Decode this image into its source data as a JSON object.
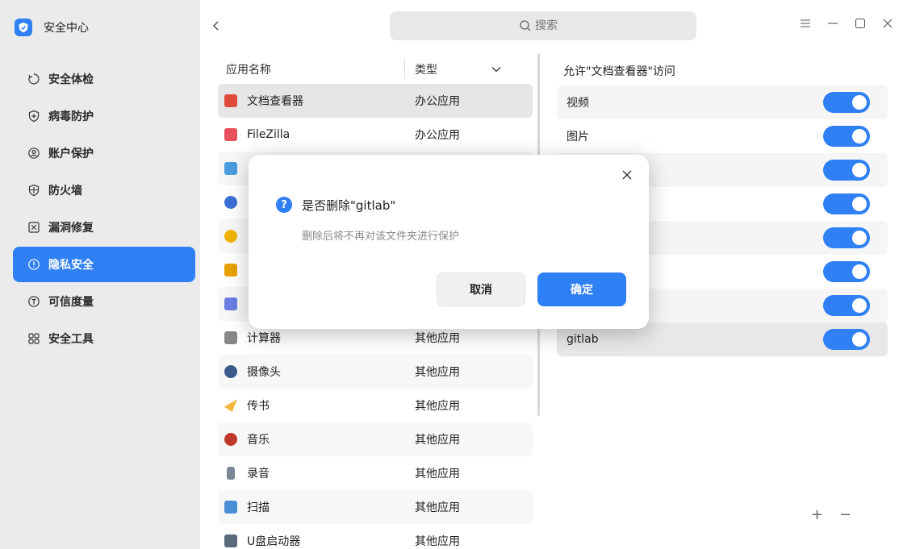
{
  "app": {
    "title": "安全中心",
    "logo_icon": "shield-logo-icon"
  },
  "sidebar": {
    "items": [
      {
        "label": "安全体检",
        "icon": "checkup-icon",
        "active": false
      },
      {
        "label": "病毒防护",
        "icon": "virus-shield-icon",
        "active": false
      },
      {
        "label": "账户保护",
        "icon": "account-icon",
        "active": false
      },
      {
        "label": "防火墙",
        "icon": "firewall-icon",
        "active": false
      },
      {
        "label": "漏洞修复",
        "icon": "vulnerability-icon",
        "active": false
      },
      {
        "label": "隐私安全",
        "icon": "privacy-icon",
        "active": true
      },
      {
        "label": "可信度量",
        "icon": "trust-icon",
        "active": false
      },
      {
        "label": "安全工具",
        "icon": "tools-icon",
        "active": false
      }
    ]
  },
  "search": {
    "placeholder": "搜索"
  },
  "table": {
    "col_name": "应用名称",
    "col_type": "类型",
    "rows": [
      {
        "name": "文档查看器",
        "type": "办公应用",
        "color": "#e04a3a"
      },
      {
        "name": "FileZilla",
        "type": "办公应用",
        "color": "#e8505b"
      },
      {
        "name": "",
        "type": "",
        "color": "#4a9de0"
      },
      {
        "name": "",
        "type": "",
        "color": "#3b6fd6"
      },
      {
        "name": "",
        "type": "",
        "color": "#f0b400"
      },
      {
        "name": "",
        "type": "",
        "color": "#e8a200"
      },
      {
        "name": "",
        "type": "",
        "color": "#6a7fe0"
      },
      {
        "name": "计算器",
        "type": "其他应用",
        "color": "#888888"
      },
      {
        "name": "摄像头",
        "type": "其他应用",
        "color": "#3c5a8a"
      },
      {
        "name": "传书",
        "type": "其他应用",
        "color": "#f4b53f"
      },
      {
        "name": "音乐",
        "type": "其他应用",
        "color": "#c0392b"
      },
      {
        "name": "录音",
        "type": "其他应用",
        "color": "#7a8796"
      },
      {
        "name": "扫描",
        "type": "其他应用",
        "color": "#4a8fd6"
      },
      {
        "name": "U盘启动器",
        "type": "其他应用",
        "color": "#5a6a7a"
      }
    ]
  },
  "permissions": {
    "title": "允许\"文档查看器\"访问",
    "items": [
      {
        "label": "视频",
        "on": true
      },
      {
        "label": "图片",
        "on": true
      },
      {
        "label": "",
        "on": true
      },
      {
        "label": "",
        "on": true
      },
      {
        "label": "",
        "on": true
      },
      {
        "label": "",
        "on": true
      },
      {
        "label": "",
        "on": true
      },
      {
        "label": "gitlab",
        "on": true
      }
    ],
    "add_label": "+",
    "remove_label": "−"
  },
  "dialog": {
    "title": "是否删除\"gitlab\"",
    "message": "删除后将不再对该文件夹进行保护",
    "cancel_label": "取消",
    "confirm_label": "确定"
  },
  "colors": {
    "accent": "#2f7ff5",
    "sidebar_bg": "#ebebeb"
  }
}
